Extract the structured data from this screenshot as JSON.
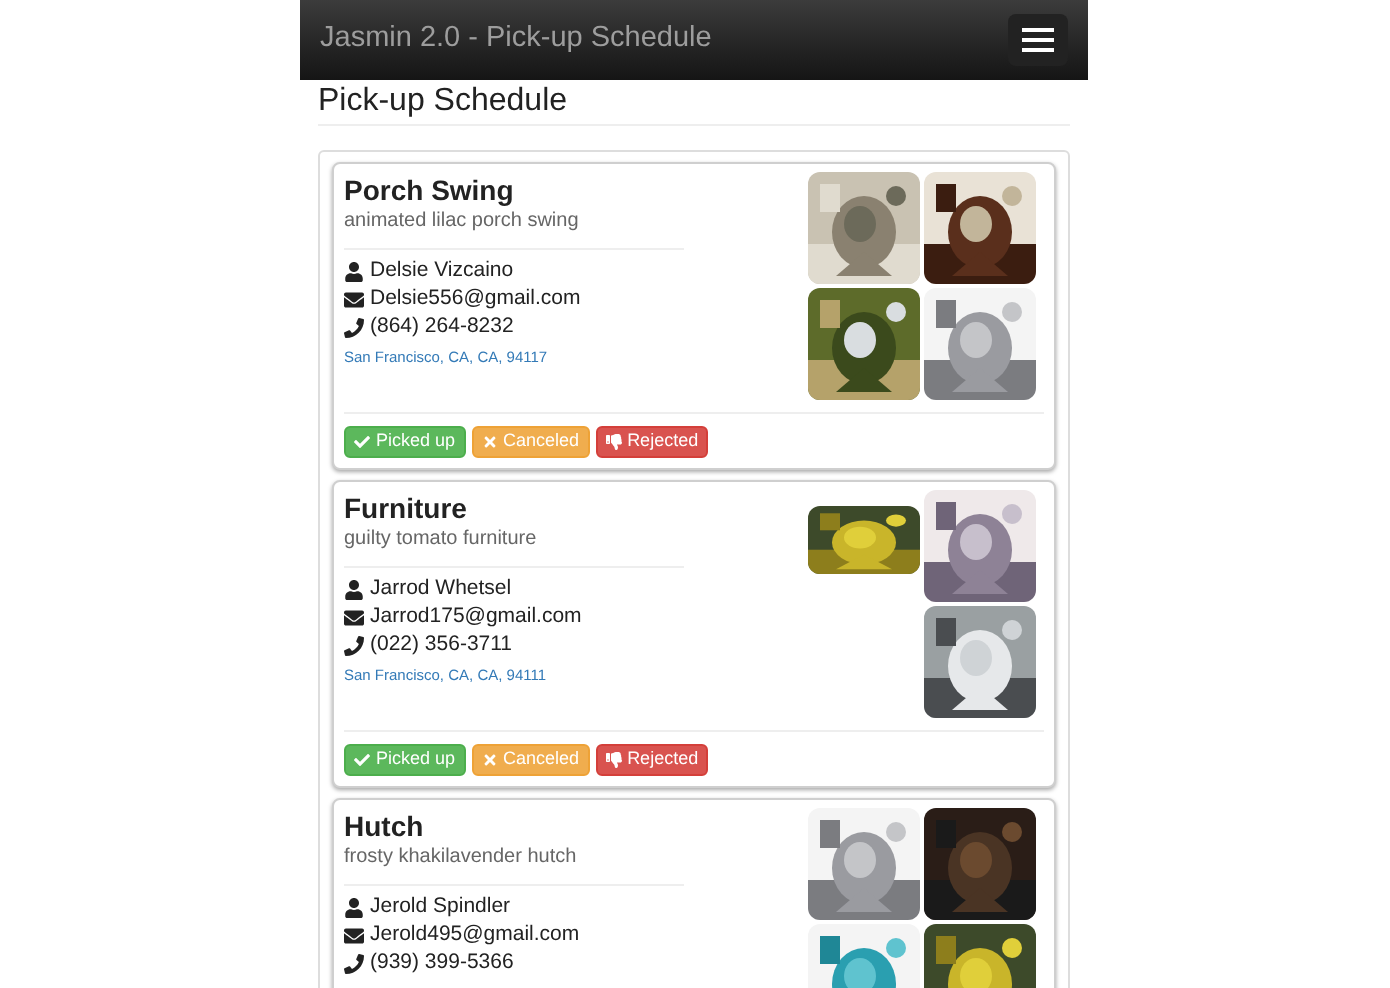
{
  "navbar": {
    "title": "Jasmin 2.0 - Pick-up Schedule"
  },
  "page_title": "Pick-up Schedule",
  "pickups": [
    {
      "title": "Porch Swing",
      "subtitle": "animated lilac porch swing",
      "name": "Delsie Vizcaino",
      "email": "Delsie556@gmail.com",
      "phone": "(864) 264-8232",
      "address": "San Francisco, CA, CA, 94117",
      "images": [
        {
          "kind": "picture"
        },
        {
          "kind": "picture"
        },
        {
          "kind": "picture"
        },
        {
          "kind": "picture"
        }
      ],
      "buttons": [
        {
          "kind": "picked",
          "label": "Picked up"
        },
        {
          "kind": "canceled",
          "label": "Canceled"
        },
        {
          "kind": "rejected",
          "label": "Rejected"
        }
      ]
    },
    {
      "title": "Furniture",
      "subtitle": "guilty tomato furniture",
      "name": "Jarrod Whetsel",
      "email": "Jarrod175@gmail.com",
      "phone": "(022) 356-3711",
      "address": "San Francisco, CA, CA, 94111",
      "images": [
        {
          "kind": "wide"
        },
        {
          "kind": "picture"
        },
        {
          "kind": "picture"
        }
      ],
      "buttons": [
        {
          "kind": "picked",
          "label": "Picked up"
        },
        {
          "kind": "canceled",
          "label": "Canceled"
        },
        {
          "kind": "rejected",
          "label": "Rejected"
        }
      ]
    },
    {
      "title": "Hutch",
      "subtitle": "frosty khakilavender hutch",
      "name": "Jerold Spindler",
      "email": "Jerold495@gmail.com",
      "phone": "(939) 399-5366",
      "images": [
        {
          "kind": "picture"
        },
        {
          "kind": "picture"
        },
        {
          "kind": "picture"
        },
        {
          "kind": "picture"
        }
      ]
    }
  ]
}
